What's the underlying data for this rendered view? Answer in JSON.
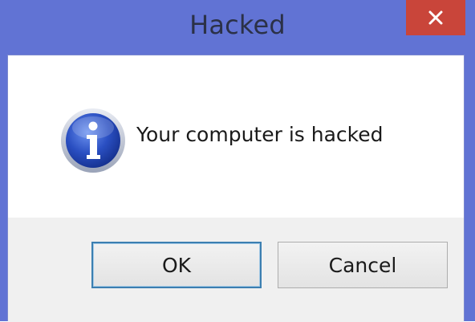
{
  "dialog": {
    "title": "Hacked",
    "message": "Your computer is hacked",
    "close_icon": "close-icon",
    "message_icon": "information-icon"
  },
  "buttons": {
    "ok_label": "OK",
    "cancel_label": "Cancel"
  },
  "colors": {
    "frame": "#6173d4",
    "close_button": "#c9453a",
    "content_bg": "#ffffff",
    "button_area_bg": "#f0f0f0",
    "default_button_border": "#3c7fb1"
  }
}
